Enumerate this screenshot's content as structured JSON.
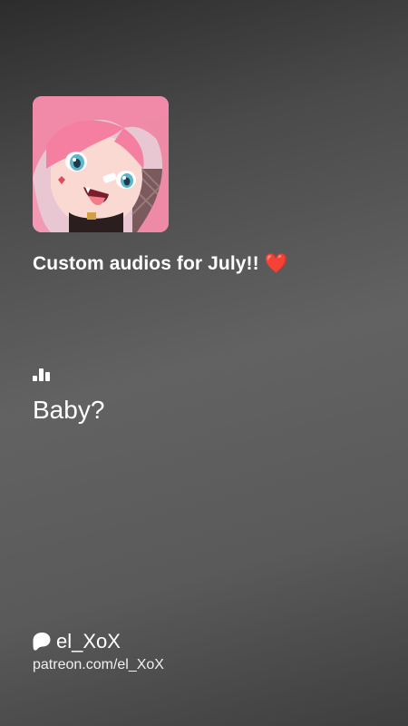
{
  "post": {
    "cover_image": "anime-character-avatar",
    "title": "Custom audios for July!! ❤️"
  },
  "audio": {
    "icon": "audio-bars-icon",
    "title": "Baby?"
  },
  "creator": {
    "icon": "patreon-icon",
    "name": "el_XoX",
    "url": "patreon.com/el_XoX"
  }
}
